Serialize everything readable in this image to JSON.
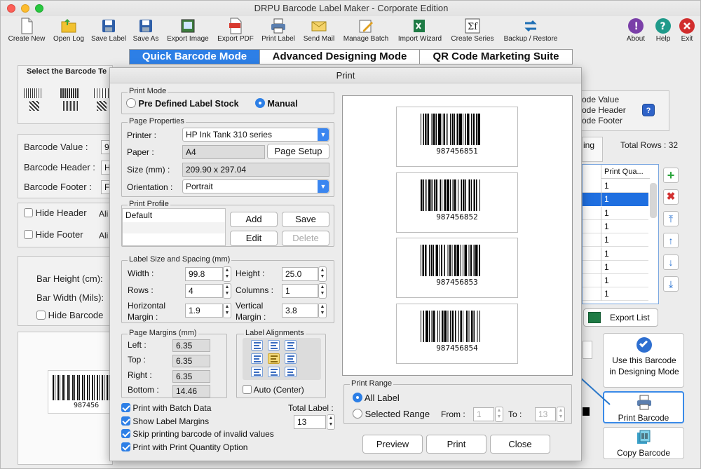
{
  "window": {
    "title": "DRPU Barcode Label Maker - Corporate Edition"
  },
  "toolbar": {
    "create_new": "Create New",
    "open_log": "Open Log",
    "save_label": "Save Label",
    "save_as": "Save As",
    "export_image": "Export Image",
    "export_pdf": "Export PDF",
    "print_label": "Print Label",
    "send_mail": "Send Mail",
    "manage_batch": "Manage Batch",
    "import_wizard": "Import Wizard",
    "create_series": "Create Series",
    "backup_restore": "Backup / Restore",
    "about": "About",
    "help": "Help",
    "exit": "Exit"
  },
  "modes": {
    "quick": "Quick Barcode Mode",
    "advanced": "Advanced Designing Mode",
    "qr": "QR Code Marketing Suite"
  },
  "background": {
    "select_barcode": "Select the Barcode Te",
    "barcode_value": "Barcode Value :",
    "barcode_value_v": "9",
    "barcode_header": "Barcode Header :",
    "barcode_header_v": "H",
    "barcode_footer": "Barcode Footer :",
    "barcode_footer_v": "F",
    "hide_header": "Hide Header",
    "hide_footer": "Hide Footer",
    "ali1": "Ali",
    "ali2": "Ali",
    "bar_height": "Bar Height (cm):",
    "bar_width": "Bar Width (Mils):",
    "hide_barcode": "Hide Barcode",
    "preview_number": "987456",
    "code_value": "ode Value",
    "code_header": "ode Header",
    "code_footer": "ode Footer",
    "ing": "ing",
    "total_rows": "Total Rows : 32",
    "print_qty_col": "Print Qua...",
    "qty_values": [
      "1",
      "1",
      "1",
      "1",
      "1",
      "1",
      "1",
      "1",
      "1"
    ],
    "export_list": "Export List",
    "use_this": "Use this Barcode in Designing Mode",
    "print_barcode": "Print Barcode",
    "copy_barcode": "Copy Barcode"
  },
  "dialog": {
    "title": "Print",
    "print_mode": "Print Mode",
    "predefined": "Pre Defined Label Stock",
    "manual": "Manual",
    "page_properties": "Page Properties",
    "printer_label": "Printer :",
    "printer_value": "HP Ink Tank 310 series",
    "paper_label": "Paper :",
    "paper_value": "A4",
    "page_setup": "Page Setup",
    "size_label": "Size (mm) :",
    "size_value": "209.90 x 297.04",
    "orientation_label": "Orientation :",
    "orientation_value": "Portrait",
    "print_profile": "Print Profile",
    "profile_default": "Default",
    "add": "Add",
    "save": "Save",
    "edit": "Edit",
    "delete": "Delete",
    "label_size_spacing": "Label Size and Spacing (mm)",
    "width_label": "Width :",
    "width_value": "99.8",
    "height_label": "Height :",
    "height_value": "25.0",
    "rows_label": "Rows :",
    "rows_value": "4",
    "columns_label": "Columns :",
    "columns_value": "1",
    "hmargin_label_1": "Horizontal",
    "hmargin_label_2": "Margin :",
    "hmargin_value": "1.9",
    "vmargin_label_1": "Vertical",
    "vmargin_label_2": "Margin :",
    "vmargin_value": "3.8",
    "page_margins": "Page Margins (mm)",
    "left_label": "Left :",
    "left_value": "6.35",
    "top_label": "Top :",
    "top_value": "6.35",
    "right_label": "Right :",
    "right_value": "6.35",
    "bottom_label": "Bottom :",
    "bottom_value": "14.46",
    "label_alignments": "Label Alignments",
    "auto_center": "Auto (Center)",
    "print_batch": "Print with Batch Data",
    "show_margins": "Show Label Margins",
    "skip_invalid": "Skip printing barcode of invalid values",
    "print_qty": "Print with Print Quantity Option",
    "total_label": "Total Label :",
    "total_value": "13",
    "labels": [
      "987456851",
      "987456852",
      "987456853",
      "987456854"
    ],
    "print_range": "Print Range",
    "all_label": "All Label",
    "selected_range": "Selected Range",
    "from_label": "From :",
    "from_value": "1",
    "to_label": "To :",
    "to_value": "13",
    "preview_btn": "Preview",
    "print_btn": "Print",
    "close_btn": "Close"
  },
  "colors": {
    "accent": "#2d7fe6",
    "arrow": "#2a77c9"
  }
}
